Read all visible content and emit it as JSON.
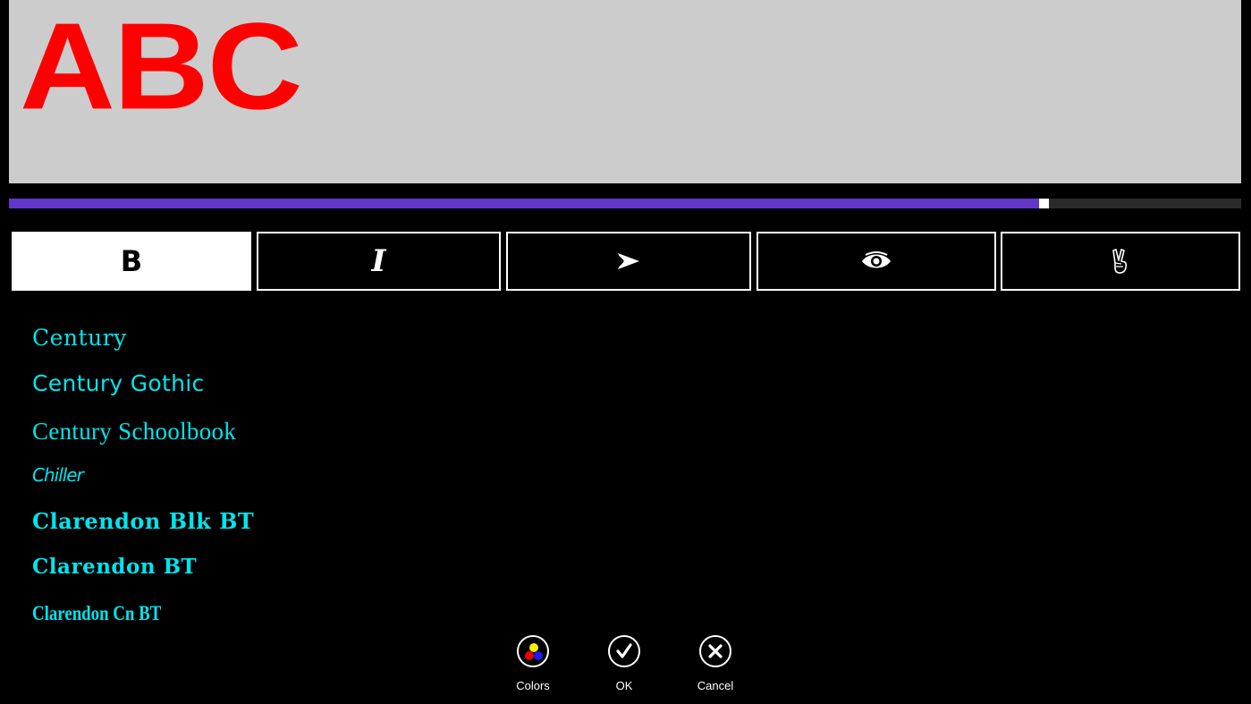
{
  "preview": {
    "text": "ABC",
    "text_color": "#ff0000",
    "background": "#cccccc"
  },
  "size_slider": {
    "value_fraction": 0.836,
    "fill_color": "#6236c8"
  },
  "style_buttons": [
    {
      "id": "bold",
      "label": "B",
      "icon": "bold-icon",
      "selected": true
    },
    {
      "id": "italic",
      "label": "I",
      "icon": "italic-icon",
      "selected": false
    },
    {
      "id": "direction",
      "icon": "send-arrow-icon",
      "selected": false
    },
    {
      "id": "visibility",
      "icon": "eye-icon",
      "selected": false
    },
    {
      "id": "fun",
      "icon": "peace-hand-icon",
      "selected": false
    }
  ],
  "font_list": {
    "color": "#00e5ee",
    "items": [
      "Century",
      "Century Gothic",
      "Century Schoolbook",
      "Chiller",
      "Clarendon Blk BT",
      "Clarendon BT",
      "Clarendon Cn BT"
    ]
  },
  "app_bar": {
    "colors_label": "Colors",
    "ok_label": "OK",
    "cancel_label": "Cancel"
  }
}
